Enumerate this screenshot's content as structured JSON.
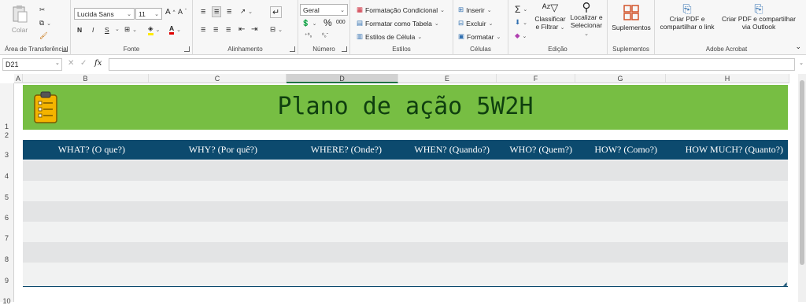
{
  "ribbon": {
    "clipboard": {
      "paste": "Colar",
      "label": "Área de Transferência"
    },
    "font": {
      "family": "Lucida Sans",
      "size": "11",
      "bold": "N",
      "italic": "I",
      "underline": "S",
      "label": "Fonte"
    },
    "alignment": {
      "label": "Alinhamento"
    },
    "number": {
      "format": "Geral",
      "label": "Número",
      "percent": "%",
      "thousands": "000"
    },
    "styles": {
      "conditional": "Formatação Condicional",
      "as_table": "Formatar como Tabela",
      "cell_styles": "Estilos de Célula",
      "label": "Estilos"
    },
    "cells": {
      "insert": "Inserir",
      "delete": "Excluir",
      "format": "Formatar",
      "label": "Células"
    },
    "editing": {
      "sort_line1": "Classificar",
      "sort_line2": "e Filtrar",
      "find_line1": "Localizar e",
      "find_line2": "Selecionar",
      "label": "Edição"
    },
    "addins": {
      "button": "Suplementos",
      "label": "Suplementos"
    },
    "acrobat": {
      "pdf_link_1": "Criar PDF e",
      "pdf_link_2": "compartilhar o link",
      "pdf_outlook_1": "Criar PDF e compartilhar",
      "pdf_outlook_2": "via Outlook",
      "label": "Adobe Acrobat"
    }
  },
  "formula_bar": {
    "name_box": "D21",
    "fx": "fx",
    "value": ""
  },
  "columns": [
    "A",
    "B",
    "C",
    "D",
    "E",
    "F",
    "G",
    "H"
  ],
  "rows": [
    "1",
    "2",
    "3",
    "4",
    "5",
    "6",
    "7",
    "8",
    "9",
    "10"
  ],
  "sheet": {
    "title": "Plano de ação 5W2H",
    "headers": [
      "WHAT? (O que?)",
      "WHY? (Por quê?)",
      "WHERE? (Onde?)",
      "WHEN? (Quando?)",
      "WHO? (Quem?)",
      "HOW? (Como?)",
      "HOW MUCH? (Quanto?)"
    ],
    "colors": {
      "banner": "#77be43",
      "header": "#0c4a6e",
      "band_dark": "#e3e4e5",
      "band_light": "#f1f2f2"
    }
  }
}
